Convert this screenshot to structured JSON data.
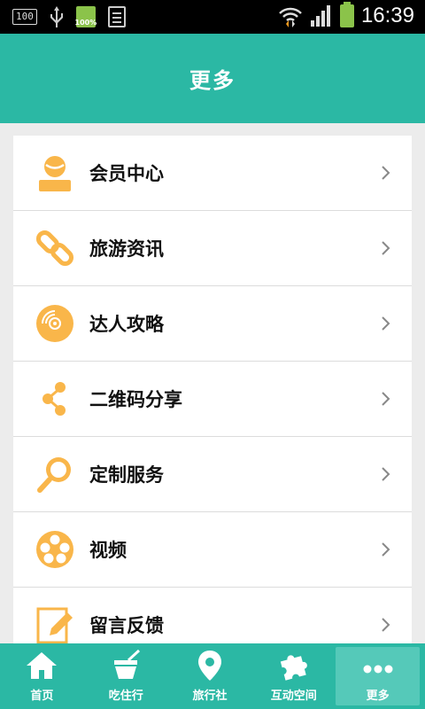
{
  "status_bar": {
    "box_left": "100",
    "battery_small_label": "100%",
    "time": "16:39"
  },
  "header": {
    "title": "更多"
  },
  "menu": {
    "items": [
      {
        "label": "会员中心",
        "icon": "member-icon"
      },
      {
        "label": "旅游资讯",
        "icon": "link-icon"
      },
      {
        "label": "达人攻略",
        "icon": "disc-icon"
      },
      {
        "label": "二维码分享",
        "icon": "share-icon"
      },
      {
        "label": "定制服务",
        "icon": "magnifier-icon"
      },
      {
        "label": "视频",
        "icon": "film-reel-icon"
      },
      {
        "label": "留言反馈",
        "icon": "edit-icon"
      }
    ]
  },
  "tabs": [
    {
      "label": "首页",
      "icon": "home-icon",
      "active": false
    },
    {
      "label": "吃住行",
      "icon": "food-bowl-icon",
      "active": false
    },
    {
      "label": "旅行社",
      "icon": "location-pin-icon",
      "active": false
    },
    {
      "label": "互动空间",
      "icon": "puzzle-icon",
      "active": false
    },
    {
      "label": "更多",
      "icon": "more-dots-icon",
      "active": true
    }
  ],
  "colors": {
    "primary": "#2bb8a4",
    "accent": "#f9b64a"
  }
}
